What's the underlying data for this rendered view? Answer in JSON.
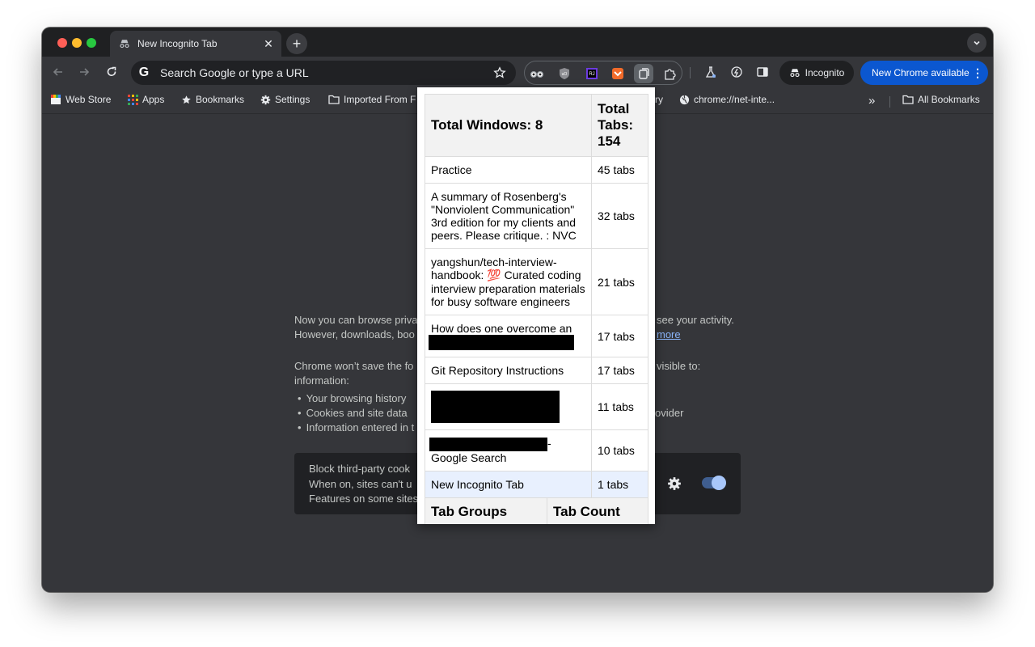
{
  "tab": {
    "title": "New Incognito Tab"
  },
  "omnibox": {
    "placeholder": "Search Google or type a URL"
  },
  "toolbar": {
    "incognito_label": "Incognito",
    "update_label": "New Chrome available"
  },
  "bookmarks": {
    "items": [
      "Web Store",
      "Apps",
      "Bookmarks",
      "Settings",
      "Imported From F",
      "ry",
      "chrome://net-inte..."
    ],
    "overflow": "»",
    "all_bookmarks": "All Bookmarks"
  },
  "incognito_page": {
    "p1_line1_a": "Now you can browse priva",
    "p1_line1_b": "see your activity.",
    "p1_line2_a": "However, downloads, boo",
    "p1_line2_link": "more",
    "p2_line1_a": "Chrome won’t save the fo",
    "p2_line1_b": "visible to:",
    "p2_line2": "information:",
    "bullets": [
      "Your browsing history",
      "Cookies and site data",
      "Information entered in t"
    ],
    "bullet_right": "ovider",
    "card_lines": [
      "Block third-party cook",
      "When on, sites can't u",
      "Features on some sites"
    ]
  },
  "popup": {
    "header": {
      "windows": "Total Windows: 8",
      "tabs": "Total Tabs: 154"
    },
    "rows": [
      {
        "title": "Practice",
        "count": "45 tabs"
      },
      {
        "title": "A summary of Rosenberg's \"Nonviolent Communication\" 3rd edition for my clients and peers. Please critique. : NVC",
        "count": "32 tabs"
      },
      {
        "title": "yangshun/tech-interview-handbook: 💯 Curated coding interview preparation materials for busy software engineers",
        "count": "21 tabs"
      },
      {
        "title": "How does one overcome an",
        "count": "17 tabs"
      },
      {
        "title": "Git Repository Instructions",
        "count": "17 tabs"
      },
      {
        "title": "",
        "count": "11 tabs"
      },
      {
        "title": "- Google Search",
        "count": "10 tabs"
      },
      {
        "title": "New Incognito Tab",
        "count": "1 tabs"
      }
    ],
    "groups_header": {
      "groups": "Tab Groups",
      "count": "Tab Count"
    }
  },
  "colors": {
    "frame": "#1f2022",
    "toolbar": "#35363a",
    "update_chip": "#0b57d0",
    "current_row": "#e8f0fe"
  }
}
